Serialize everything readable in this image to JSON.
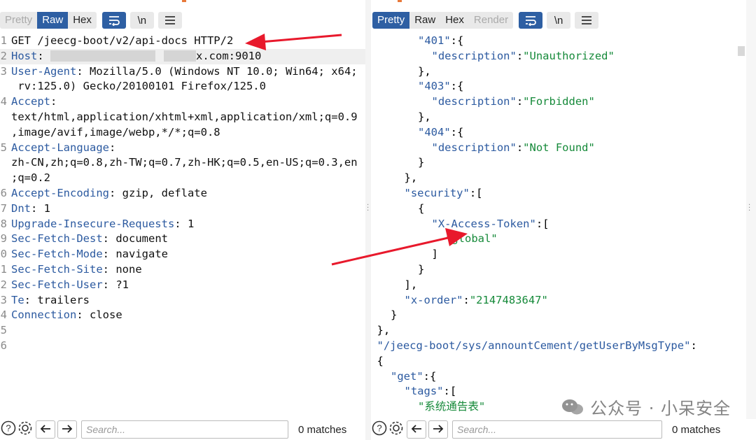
{
  "left": {
    "tabs": [
      {
        "label": "Pretty",
        "state": "muted"
      },
      {
        "label": "Raw",
        "state": "active"
      },
      {
        "label": "Hex",
        "state": "normal"
      }
    ],
    "newline_label": "\\n",
    "lines": [
      {
        "num": "1",
        "key": "",
        "sep": "",
        "value": "GET /jeecg-boot/v2/api-docs HTTP/2"
      },
      {
        "num": "2",
        "key": "Host",
        "sep": ": ",
        "value": "x.com:9010"
      },
      {
        "num": "3",
        "key": "User-Agent",
        "sep": ": ",
        "value": "Mozilla/5.0 (Windows NT 10.0; Win64; x64;"
      },
      {
        "num": "",
        "key": "",
        "sep": "",
        "value": " rv:125.0) Gecko/20100101 Firefox/125.0"
      },
      {
        "num": "4",
        "key": "Accept",
        "sep": ":",
        "value": ""
      },
      {
        "num": "",
        "key": "",
        "sep": "",
        "value": "text/html,application/xhtml+xml,application/xml;q=0.9"
      },
      {
        "num": "",
        "key": "",
        "sep": "",
        "value": ",image/avif,image/webp,*/*;q=0.8"
      },
      {
        "num": "5",
        "key": "Accept-Language",
        "sep": ":",
        "value": ""
      },
      {
        "num": "",
        "key": "",
        "sep": "",
        "value": "zh-CN,zh;q=0.8,zh-TW;q=0.7,zh-HK;q=0.5,en-US;q=0.3,en"
      },
      {
        "num": "",
        "key": "",
        "sep": "",
        "value": ";q=0.2"
      },
      {
        "num": "6",
        "key": "Accept-Encoding",
        "sep": ": ",
        "value": "gzip, deflate"
      },
      {
        "num": "7",
        "key": "Dnt",
        "sep": ": ",
        "value": "1"
      },
      {
        "num": "8",
        "key": "Upgrade-Insecure-Requests",
        "sep": ": ",
        "value": "1"
      },
      {
        "num": "9",
        "key": "Sec-Fetch-Dest",
        "sep": ": ",
        "value": "document"
      },
      {
        "num": "0",
        "key": "Sec-Fetch-Mode",
        "sep": ": ",
        "value": "navigate"
      },
      {
        "num": "1",
        "key": "Sec-Fetch-Site",
        "sep": ": ",
        "value": "none"
      },
      {
        "num": "2",
        "key": "Sec-Fetch-User",
        "sep": ": ",
        "value": "?1"
      },
      {
        "num": "3",
        "key": "Te",
        "sep": ": ",
        "value": "trailers"
      },
      {
        "num": "4",
        "key": "Connection",
        "sep": ": ",
        "value": "close"
      },
      {
        "num": "5",
        "key": "",
        "sep": "",
        "value": ""
      },
      {
        "num": "6",
        "key": "",
        "sep": "",
        "value": ""
      }
    ],
    "search_placeholder": "Search...",
    "matches": "0 matches"
  },
  "right": {
    "tabs": [
      {
        "label": "Pretty",
        "state": "active"
      },
      {
        "label": "Raw",
        "state": "normal"
      },
      {
        "label": "Hex",
        "state": "normal"
      },
      {
        "label": "Render",
        "state": "muted"
      }
    ],
    "newline_label": "\\n",
    "json_lines": [
      {
        "indent": 6,
        "parts": [
          {
            "t": "k",
            "s": "\"401\""
          },
          {
            "t": "p",
            "s": ":{"
          }
        ]
      },
      {
        "indent": 7,
        "parts": [
          {
            "t": "k",
            "s": "\"description\""
          },
          {
            "t": "p",
            "s": ":"
          },
          {
            "t": "s",
            "s": "\"Unauthorized\""
          }
        ]
      },
      {
        "indent": 6,
        "parts": [
          {
            "t": "p",
            "s": "},"
          }
        ]
      },
      {
        "indent": 6,
        "parts": [
          {
            "t": "k",
            "s": "\"403\""
          },
          {
            "t": "p",
            "s": ":{"
          }
        ]
      },
      {
        "indent": 7,
        "parts": [
          {
            "t": "k",
            "s": "\"description\""
          },
          {
            "t": "p",
            "s": ":"
          },
          {
            "t": "s",
            "s": "\"Forbidden\""
          }
        ]
      },
      {
        "indent": 6,
        "parts": [
          {
            "t": "p",
            "s": "},"
          }
        ]
      },
      {
        "indent": 6,
        "parts": [
          {
            "t": "k",
            "s": "\"404\""
          },
          {
            "t": "p",
            "s": ":{"
          }
        ]
      },
      {
        "indent": 7,
        "parts": [
          {
            "t": "k",
            "s": "\"description\""
          },
          {
            "t": "p",
            "s": ":"
          },
          {
            "t": "s",
            "s": "\"Not Found\""
          }
        ]
      },
      {
        "indent": 6,
        "parts": [
          {
            "t": "p",
            "s": "}"
          }
        ]
      },
      {
        "indent": 5,
        "parts": [
          {
            "t": "p",
            "s": "},"
          }
        ]
      },
      {
        "indent": 5,
        "parts": [
          {
            "t": "k",
            "s": "\"security\""
          },
          {
            "t": "p",
            "s": ":["
          }
        ]
      },
      {
        "indent": 6,
        "parts": [
          {
            "t": "p",
            "s": "{"
          }
        ]
      },
      {
        "indent": 7,
        "parts": [
          {
            "t": "k",
            "s": "\"X-Access-Token\""
          },
          {
            "t": "p",
            "s": ":["
          }
        ]
      },
      {
        "indent": 8,
        "parts": [
          {
            "t": "s",
            "s": "\"global\""
          }
        ]
      },
      {
        "indent": 7,
        "parts": [
          {
            "t": "p",
            "s": "]"
          }
        ]
      },
      {
        "indent": 6,
        "parts": [
          {
            "t": "p",
            "s": "}"
          }
        ]
      },
      {
        "indent": 5,
        "parts": [
          {
            "t": "p",
            "s": "],"
          }
        ]
      },
      {
        "indent": 5,
        "parts": [
          {
            "t": "k",
            "s": "\"x-order\""
          },
          {
            "t": "p",
            "s": ":"
          },
          {
            "t": "s",
            "s": "\"2147483647\""
          }
        ]
      },
      {
        "indent": 4,
        "parts": [
          {
            "t": "p",
            "s": "}"
          }
        ]
      },
      {
        "indent": 3,
        "parts": [
          {
            "t": "p",
            "s": "},"
          }
        ]
      },
      {
        "indent": 3,
        "parts": [
          {
            "t": "k",
            "s": "\"/jeecg-boot/sys/annountCement/getUserByMsgType\""
          },
          {
            "t": "p",
            "s": ":"
          }
        ]
      },
      {
        "indent": 3,
        "parts": [
          {
            "t": "p",
            "s": "{"
          }
        ]
      },
      {
        "indent": 4,
        "parts": [
          {
            "t": "k",
            "s": "\"get\""
          },
          {
            "t": "p",
            "s": ":{"
          }
        ]
      },
      {
        "indent": 5,
        "parts": [
          {
            "t": "k",
            "s": "\"tags\""
          },
          {
            "t": "p",
            "s": ":["
          }
        ]
      },
      {
        "indent": 6,
        "parts": [
          {
            "t": "s",
            "s": "\"系统通告表\""
          }
        ]
      }
    ],
    "search_placeholder": "Search...",
    "matches": "0 matches"
  },
  "watermark": "公众号 · 小呆安全",
  "colors": {
    "accent": "#2e5fa3",
    "arrow": "#e8192c",
    "key": "#2c5aa0",
    "string": "#168a3a"
  }
}
